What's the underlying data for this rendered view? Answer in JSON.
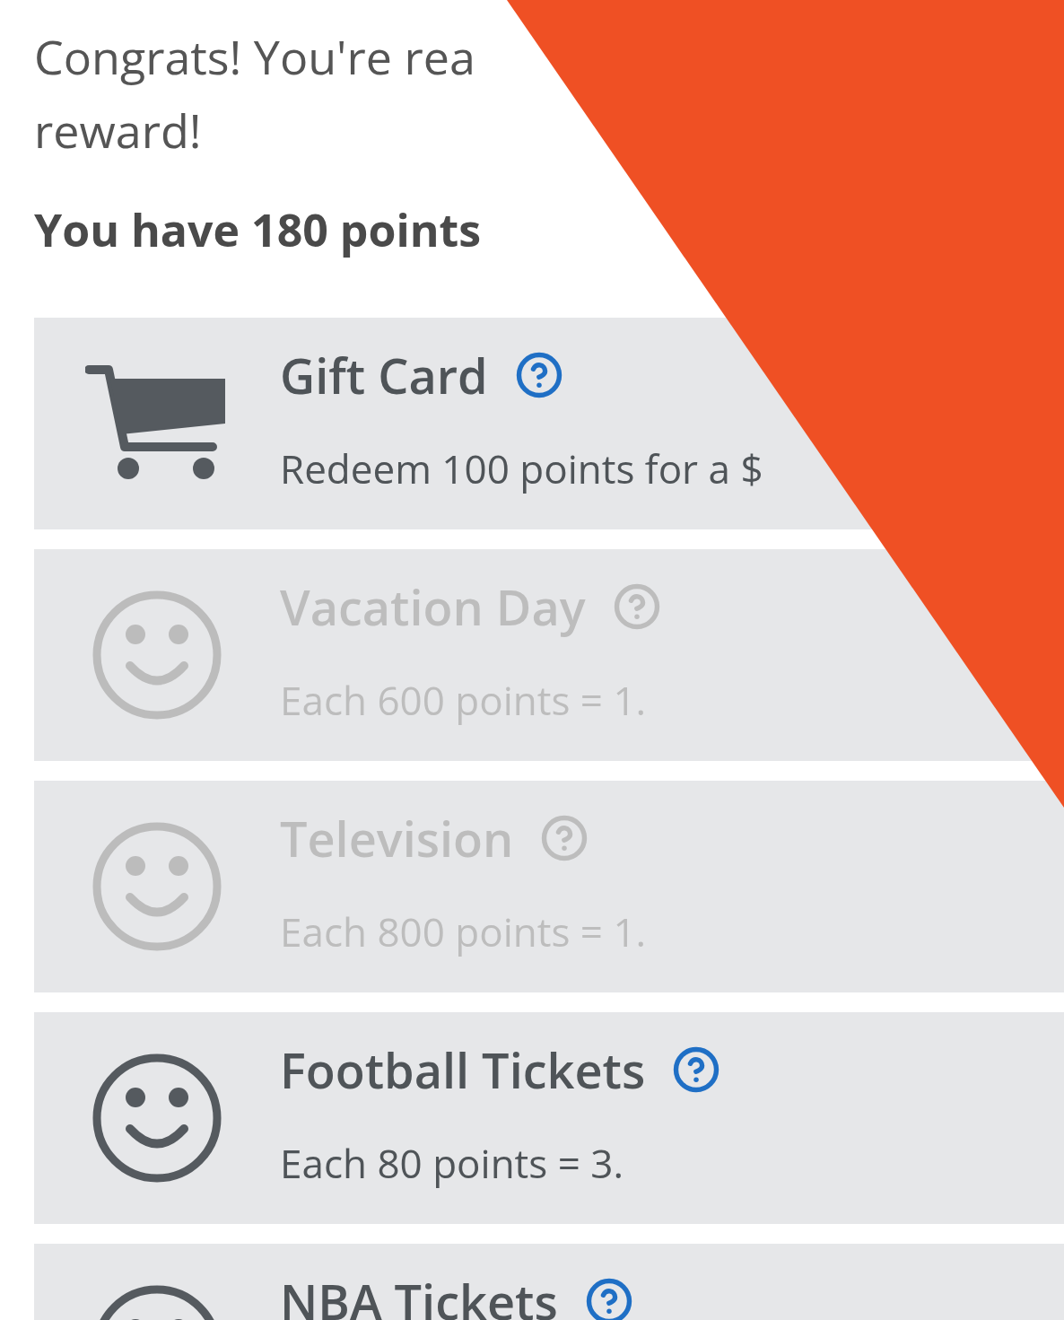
{
  "heading": {
    "line_1": "Congrats! You're rea",
    "line_2": "reward!"
  },
  "points_summary": "You have 180 points",
  "rewards": [
    {
      "kind": "cart",
      "title": "Gift Card",
      "description": "Redeem 100 points for a $",
      "disabled": false
    },
    {
      "kind": "smiley",
      "title": "Vacation Day",
      "description": "Each 600 points = 1.",
      "disabled": true
    },
    {
      "kind": "smiley",
      "title": "Television",
      "description": "Each 800 points = 1.",
      "disabled": true
    },
    {
      "kind": "smiley",
      "title": "Football Tickets",
      "description": "Each 80 points = 3.",
      "disabled": false
    },
    {
      "kind": "smiley",
      "title": "NBA Tickets",
      "disabled": false
    }
  ]
}
